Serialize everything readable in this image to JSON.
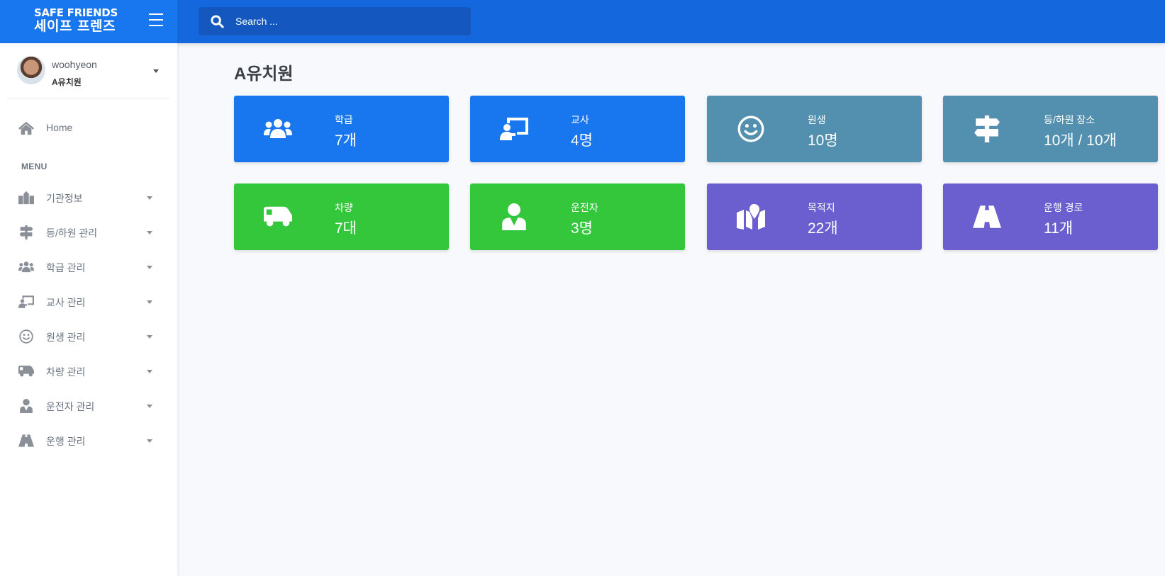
{
  "brand": {
    "name_en": "SAFE FRIENDS",
    "name_ko": "세이프 프렌즈"
  },
  "search": {
    "placeholder": "Search ..."
  },
  "user": {
    "name": "woohyeon",
    "organization": "A유치원"
  },
  "sidebar": {
    "home_label": "Home",
    "menu_heading": "MENU",
    "items": [
      {
        "label": "기관정보",
        "icon": "school-icon"
      },
      {
        "label": "등/하원 관리",
        "icon": "signpost-icon"
      },
      {
        "label": "학급 관리",
        "icon": "users-icon"
      },
      {
        "label": "교사 관리",
        "icon": "chalkboard-teacher-icon"
      },
      {
        "label": "원생 관리",
        "icon": "smile-icon"
      },
      {
        "label": "차량 관리",
        "icon": "shuttle-van-icon"
      },
      {
        "label": "운전자 관리",
        "icon": "user-tie-icon"
      },
      {
        "label": "운행 관리",
        "icon": "road-icon"
      }
    ]
  },
  "main": {
    "title": "A유치원",
    "cards": [
      {
        "label": "학급",
        "value": "7개",
        "icon": "users-icon",
        "color": "#1877ee"
      },
      {
        "label": "교사",
        "value": "4명",
        "icon": "chalkboard-teacher-icon",
        "color": "#1877ee"
      },
      {
        "label": "원생",
        "value": "10명",
        "icon": "smile-icon",
        "color": "#538fae"
      },
      {
        "label": "등/하원 장소",
        "value": "10개 / 10개",
        "icon": "signpost-icon",
        "color": "#538fae"
      },
      {
        "label": "차량",
        "value": "7대",
        "icon": "shuttle-van-icon",
        "color": "#34c73c"
      },
      {
        "label": "운전자",
        "value": "3명",
        "icon": "user-tie-icon",
        "color": "#34c73c"
      },
      {
        "label": "목적지",
        "value": "22개",
        "icon": "map-marked-icon",
        "color": "#6b5fd0"
      },
      {
        "label": "운행 경로",
        "value": "11개",
        "icon": "road-icon",
        "color": "#6b5fd0"
      }
    ]
  },
  "colors": {
    "topbar": "#1467dc",
    "brand_bg": "#1877ee",
    "search_bg": "#1458bf",
    "page_bg": "#f8f9fc"
  }
}
